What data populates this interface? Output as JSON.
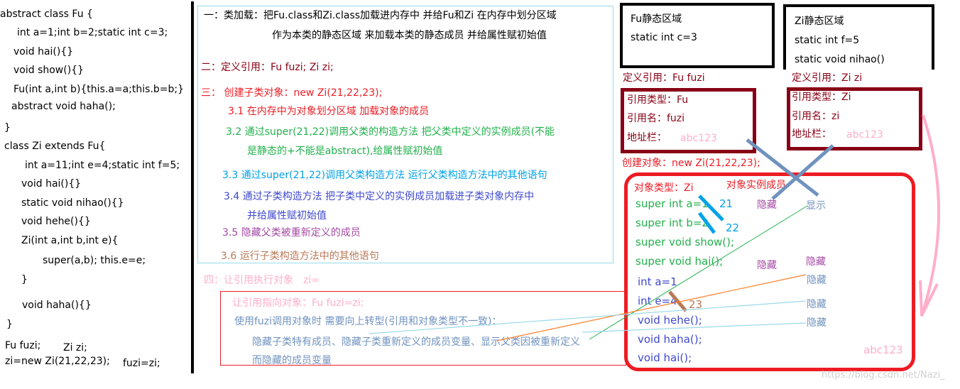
{
  "code": {
    "lines": [
      "abstract class Fu {",
      "  int a=1;int b=2;static int c=3;",
      "void hai(){}",
      "void show(){}",
      "Fu(int a,int b){this.a=a;this.b=b;}",
      "abstract void haha();",
      "}",
      "class Zi extends Fu{",
      "int a=11;int e=4;static int f=5;",
      "void hai(){}",
      "static void nihao(){}",
      "void hehe(){}",
      "Zi(int a,int b,int e){",
      "super(a,b); this.e=e;",
      "}",
      "void haha(){}",
      "}"
    ],
    "decl1": "Fu fuzi;",
    "decl2": "Zi zi;",
    "create": "zi=new Zi(21,22,23);",
    "assign": "fuzi=zi;"
  },
  "steps": {
    "s1a": "一：类加载：把Fu.class和Zi.class加载进内存中 并给Fu和Zi 在内存中划分区域",
    "s1b": "作为本类的静态区域 来加载本类的静态成员  并给属性赋初始值",
    "s2": "二：定义引用：Fu fuzi;   Zi zi;",
    "s3": "三：  创建子类对象：new Zi(21,22,23);",
    "s31": "3.1 在内存中为对象划分区域 加载对象的成员",
    "s32a": "3.2 通过super(21,22)调用父类的构造方法 把父类中定义的实例成员(不能",
    "s32b": "是静态的+不能是abstract),给属性赋初始值",
    "s33": "3.3 通过super(21,22)调用父类构造方法 运行父类构造方法中的其他语句",
    "s34a": "3.4 通过子类构造方法 把子类中定义的实例成员加载进子类对象内存中",
    "s34b": "并给属性赋初始值",
    "s35": "3.5 隐藏父类被重新定义的成员",
    "s36": "3.6 运行子类构造方法中的其他语句",
    "s4": "四：让引用执行对象　zi=",
    "s4a": "让引用指向对象：Fu fuzi=zi;",
    "s4b": "使用fuzi调用对象时 需要向上转型(引用和对象类型不一致)：",
    "s4c": "隐藏子类特有成员、隐藏子类重新定义的成员变量、显示父类因被重新定义",
    "s4d": "而隐藏的成员变量"
  },
  "fu_static": {
    "title": "Fu静态区域",
    "l1": "static int c=3"
  },
  "zi_static": {
    "title": "Zi静态区域",
    "l1": "static int f=5",
    "l2": "static void nihao()"
  },
  "fu_ref": {
    "label": "定义引用：Fu fuzi",
    "type": "引用类型：Fu",
    "name": "引用名：fuzi",
    "addr": "地址栏：",
    "addr_val": "abc123"
  },
  "zi_ref": {
    "label": "定义引用：Zi zi",
    "type": "引用类型：Zi",
    "name": "引用名：zi",
    "addr": "地址栏：",
    "addr_val": "abc123"
  },
  "object": {
    "create": "创建对象：new Zi(21,22,23);",
    "type": "对象类型：Zi",
    "members_label": "对象实例成员",
    "super_members": [
      "super int a=1",
      "super int b=2",
      "super void show();",
      "super void hai();"
    ],
    "own_members": [
      "int a=1",
      "int e=4",
      "void hehe();",
      "void haha();",
      "void hai();"
    ],
    "v21": "21",
    "v22": "22",
    "v23": "23",
    "hide": "隐藏",
    "show": "显示",
    "address": "abc123"
  },
  "watermark": "https://blog.csdn.net/Nazi_",
  "colors": {
    "red": "#ed1c24",
    "darkred": "#880015",
    "green": "#22b14c",
    "cyan": "#00a2e8",
    "indigo": "#3f48cc",
    "purple": "#a349a4",
    "brown": "#b97a57",
    "pink": "#ffaec9",
    "steel": "#7092be"
  }
}
